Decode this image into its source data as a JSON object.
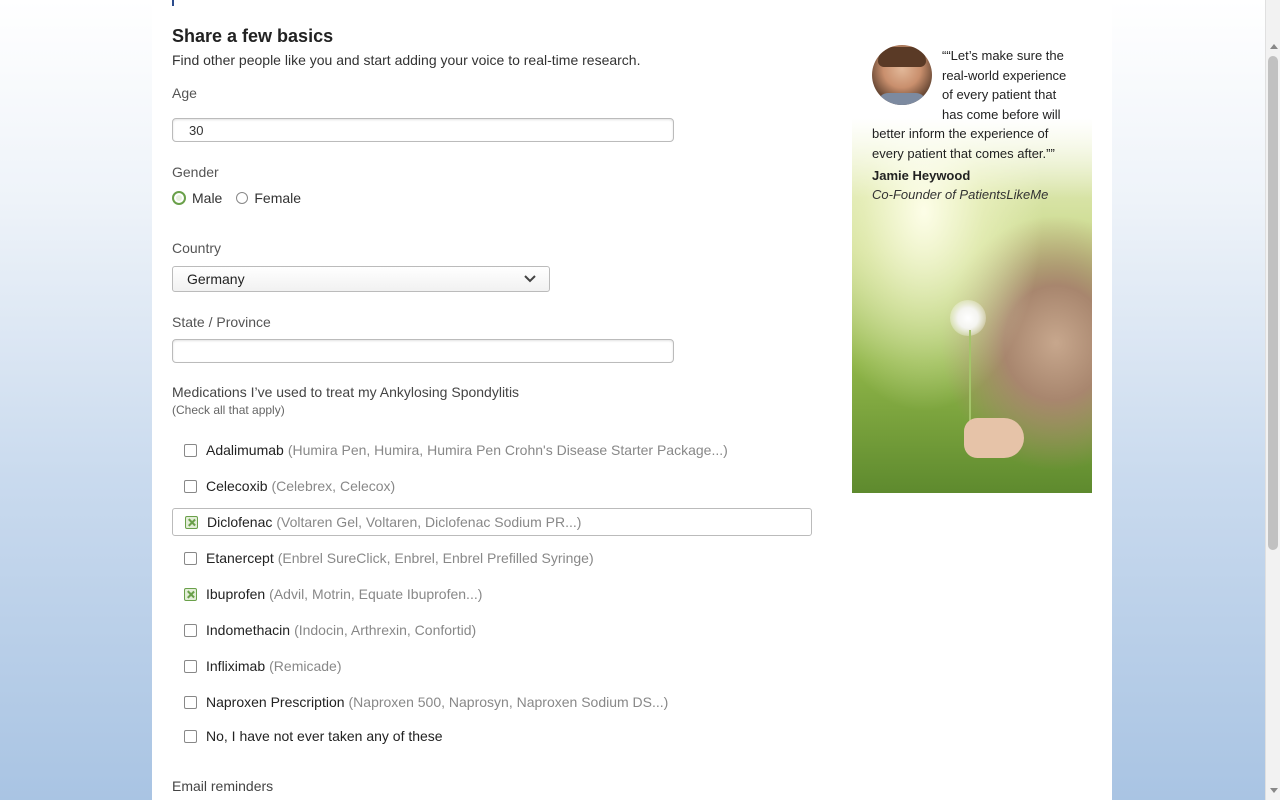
{
  "form": {
    "heading": "Share a few basics",
    "subtitle": "Find other people like you and start adding your voice to real-time research.",
    "age_label": "Age",
    "age_value": "30",
    "gender_label": "Gender",
    "gender_options": [
      {
        "label": "Male",
        "selected": true
      },
      {
        "label": "Female",
        "selected": false
      }
    ],
    "country_label": "Country",
    "country_value": "Germany",
    "state_label": "State / Province",
    "state_value": "",
    "medications_title": "Medications I’ve used to treat my Ankylosing Spondylitis",
    "medications_hint": "(Check all that apply)",
    "medications": [
      {
        "name": "Adalimumab",
        "brands": "(Humira Pen, Humira, Humira Pen Crohn's Disease Starter Package...)",
        "checked": false
      },
      {
        "name": "Celecoxib",
        "brands": "(Celebrex, Celecox)",
        "checked": false
      },
      {
        "name": "Diclofenac",
        "brands": "(Voltaren Gel, Voltaren, Diclofenac Sodium PR...)",
        "checked": true
      },
      {
        "name": "Etanercept",
        "brands": "(Enbrel SureClick, Enbrel, Enbrel Prefilled Syringe)",
        "checked": false
      },
      {
        "name": "Ibuprofen",
        "brands": "(Advil, Motrin, Equate Ibuprofen...)",
        "checked": true
      },
      {
        "name": "Indomethacin",
        "brands": "(Indocin, Arthrexin, Confortid)",
        "checked": false
      },
      {
        "name": "Infliximab",
        "brands": "(Remicade)",
        "checked": false
      },
      {
        "name": "Naproxen Prescription",
        "brands": "(Naproxen 500, Naprosyn, Naproxen Sodium DS...)",
        "checked": false
      },
      {
        "name": "No, I have not ever taken any of these",
        "brands": "",
        "checked": false
      }
    ],
    "email_label": "Email reminders"
  },
  "testimonial": {
    "quote": "““Let’s make sure the real-world experience of every patient that has come before will better inform the experience of every patient that comes after.””",
    "name": "Jamie Heywood",
    "role": "Co-Founder of PatientsLikeMe"
  },
  "colors": {
    "accent_green": "#6aa04a",
    "background_blue": "#a9c4e3"
  }
}
